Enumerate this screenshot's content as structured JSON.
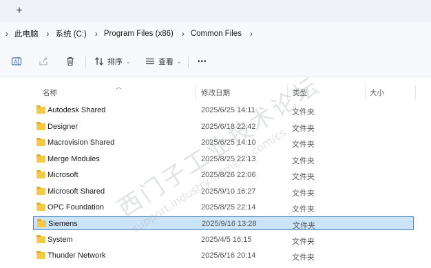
{
  "tabbar": {
    "new_tab_symbol": "+"
  },
  "breadcrumb": {
    "items": [
      "此电脑",
      "系统 (C:)",
      "Program Files (x86)",
      "Common Files"
    ]
  },
  "toolbar": {
    "sort_label": "排序",
    "view_label": "查看",
    "more_label": "•••"
  },
  "columns": {
    "name": "名称",
    "modified": "修改日期",
    "type": "类型",
    "size": "大小"
  },
  "files": [
    {
      "name": "Autodesk Shared",
      "modified": "2025/6/25 14:11",
      "type": "文件夹",
      "selected": false
    },
    {
      "name": "Designer",
      "modified": "2025/6/18 22:42",
      "type": "文件夹",
      "selected": false
    },
    {
      "name": "Macrovision Shared",
      "modified": "2025/6/25 14:10",
      "type": "文件夹",
      "selected": false
    },
    {
      "name": "Merge Modules",
      "modified": "2025/8/25 22:13",
      "type": "文件夹",
      "selected": false
    },
    {
      "name": "Microsoft",
      "modified": "2025/8/26 22:06",
      "type": "文件夹",
      "selected": false
    },
    {
      "name": "Microsoft Shared",
      "modified": "2025/9/10 16:27",
      "type": "文件夹",
      "selected": false
    },
    {
      "name": "OPC Foundation",
      "modified": "2025/8/25 22:14",
      "type": "文件夹",
      "selected": false
    },
    {
      "name": "Siemens",
      "modified": "2025/9/16 13:28",
      "type": "文件夹",
      "selected": true
    },
    {
      "name": "System",
      "modified": "2025/4/5 16:15",
      "type": "文件夹",
      "selected": false
    },
    {
      "name": "Thunder Network",
      "modified": "2025/6/16 20:14",
      "type": "文件夹",
      "selected": false
    }
  ],
  "watermark": {
    "line1": "西门子工业技术论坛",
    "line2": "support.industry.siemens.com/cs"
  },
  "colors": {
    "selection_bg": "#cce4f7",
    "selection_border": "#4f86c6",
    "folder": "#f3c94b"
  }
}
